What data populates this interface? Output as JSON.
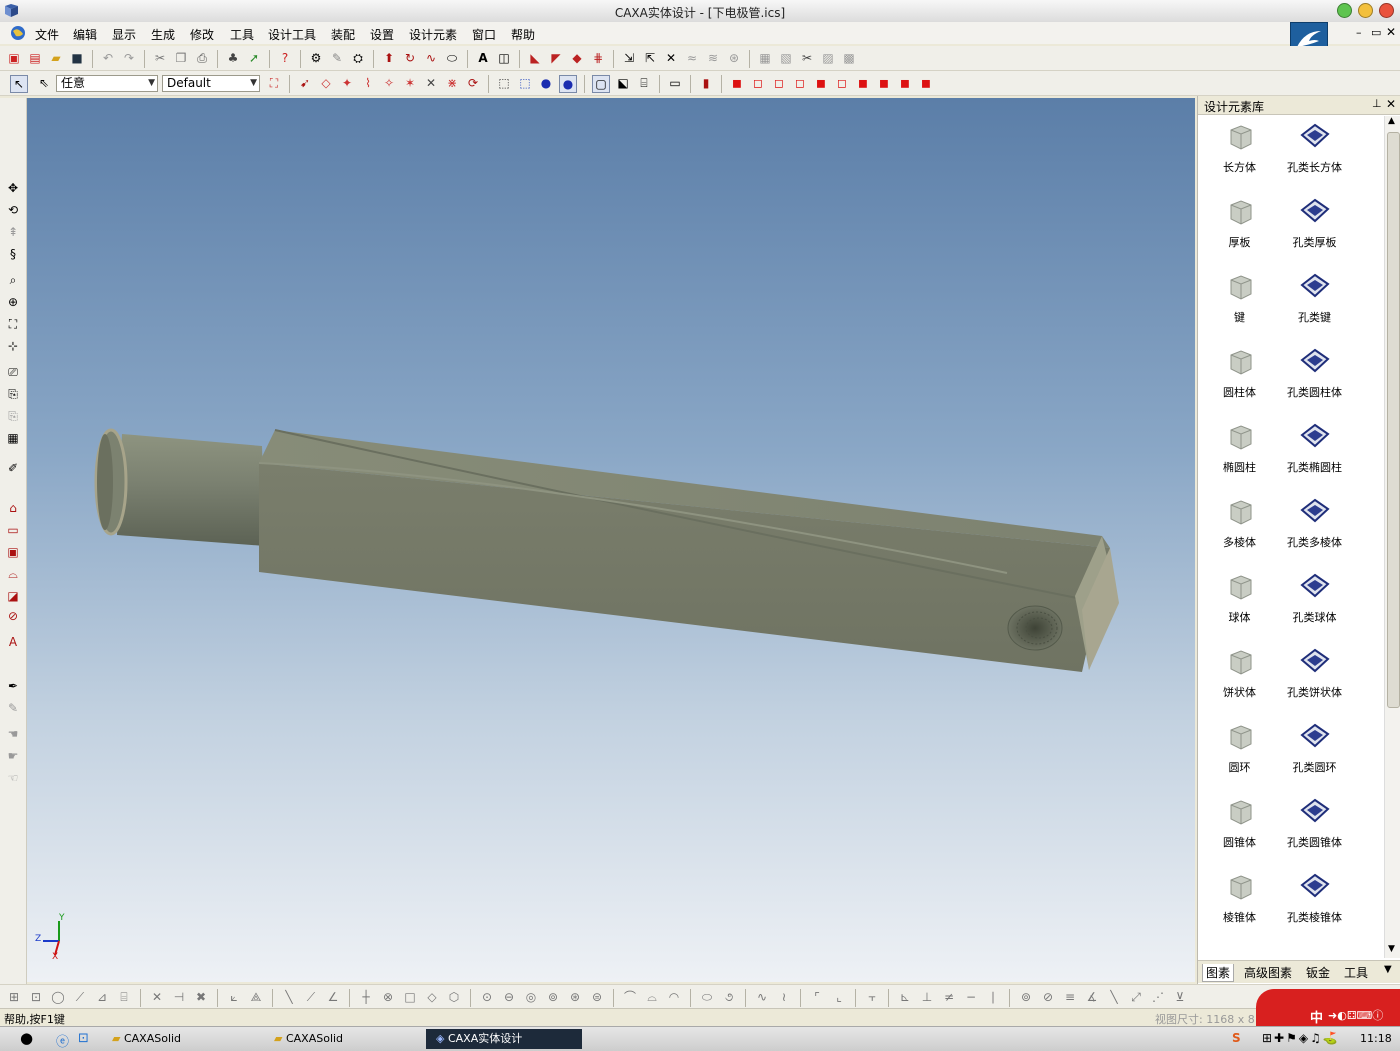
{
  "window": {
    "title": "CAXA实体设计 - [下电极管.ics]"
  },
  "menu": [
    "文件",
    "编辑",
    "显示",
    "生成",
    "修改",
    "工具",
    "设计工具",
    "装配",
    "设置",
    "设计元素",
    "窗口",
    "帮助"
  ],
  "toolbar": {
    "filter_value": "任意",
    "style_value": "Default"
  },
  "panel": {
    "title": "设计元素库",
    "elements": [
      {
        "label": "长方体",
        "icon": "box-icon"
      },
      {
        "label": "孔类长方体",
        "icon": "hole-box-icon"
      },
      {
        "label": "厚板",
        "icon": "slab-icon"
      },
      {
        "label": "孔类厚板",
        "icon": "hole-slab-icon"
      },
      {
        "label": "键",
        "icon": "key-icon"
      },
      {
        "label": "孔类键",
        "icon": "hole-key-icon"
      },
      {
        "label": "圆柱体",
        "icon": "cylinder-icon"
      },
      {
        "label": "孔类圆柱体",
        "icon": "hole-cylinder-icon"
      },
      {
        "label": "椭圆柱",
        "icon": "ellipse-cylinder-icon"
      },
      {
        "label": "孔类椭圆柱",
        "icon": "hole-ellipse-cylinder-icon"
      },
      {
        "label": "多棱体",
        "icon": "prism-icon"
      },
      {
        "label": "孔类多棱体",
        "icon": "hole-prism-icon"
      },
      {
        "label": "球体",
        "icon": "sphere-icon"
      },
      {
        "label": "孔类球体",
        "icon": "hole-sphere-icon"
      },
      {
        "label": "饼状体",
        "icon": "pie-icon"
      },
      {
        "label": "孔类饼状体",
        "icon": "hole-pie-icon"
      },
      {
        "label": "圆环",
        "icon": "torus-icon"
      },
      {
        "label": "孔类圆环",
        "icon": "hole-torus-icon"
      },
      {
        "label": "圆锥体",
        "icon": "cone-icon"
      },
      {
        "label": "孔类圆锥体",
        "icon": "hole-cone-icon"
      },
      {
        "label": "棱锥体",
        "icon": "pyramid-icon"
      },
      {
        "label": "孔类棱锥体",
        "icon": "hole-pyramid-icon"
      }
    ],
    "tabs": [
      "图素",
      "高级图素",
      "钣金",
      "工具"
    ]
  },
  "axes": {
    "y": "Y",
    "z": "Z",
    "x": "X"
  },
  "status": {
    "help": "帮助,按F1键",
    "view_size": "视图尺寸: 1168 x 8"
  },
  "taskbar": {
    "items": [
      "CAXASolid",
      "CAXASolid",
      "CAXA实体设计"
    ],
    "ime": "中",
    "clock": "11:18"
  }
}
